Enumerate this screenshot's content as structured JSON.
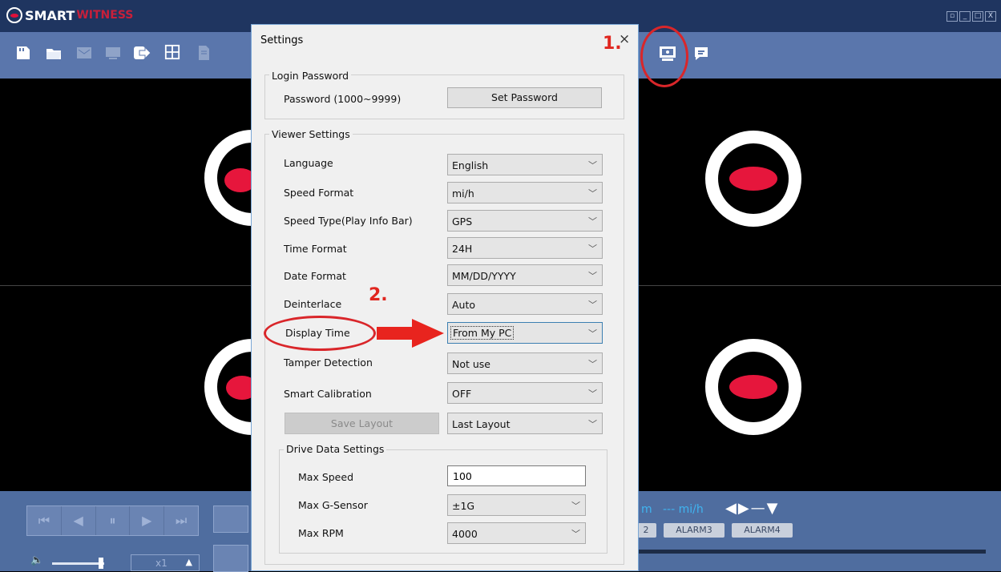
{
  "app": {
    "logo_text_1": "SMART",
    "logo_text_2": "WITNESS"
  },
  "window_controls": [
    "▫",
    "_",
    "□",
    "X"
  ],
  "dialog": {
    "title": "Settings",
    "close_glyph": "×",
    "login_password": {
      "legend": "Login Password",
      "password_label": "Password (1000~9999)",
      "set_password_button": "Set Password"
    },
    "viewer_settings": {
      "legend": "Viewer Settings",
      "rows": [
        {
          "label": "Language",
          "value": "English"
        },
        {
          "label": "Speed Format",
          "value": "mi/h"
        },
        {
          "label": "Speed Type(Play Info Bar)",
          "value": "GPS"
        },
        {
          "label": "Time Format",
          "value": "24H"
        },
        {
          "label": "Date Format",
          "value": "MM/DD/YYYY"
        },
        {
          "label": "Deinterlace",
          "value": "Auto"
        },
        {
          "label": "Display Time",
          "value": "From My PC"
        },
        {
          "label": "Tamper Detection",
          "value": "Not use"
        },
        {
          "label": "Smart Calibration",
          "value": "OFF"
        }
      ],
      "save_layout_button": "Save Layout",
      "layout_select": "Last Layout"
    },
    "drive_data": {
      "legend": "Drive Data Settings",
      "max_speed_label": "Max Speed",
      "max_speed_value": "100",
      "max_gsensor_label": "Max G-Sensor",
      "max_gsensor_value": "±1G",
      "max_rpm_label": "Max RPM",
      "max_rpm_value": "4000"
    }
  },
  "annotations": {
    "step1": "1.",
    "step2": "2."
  },
  "playback": {
    "speed_label": "x1",
    "speed_up": "▲",
    "info_unit_m": "m",
    "info_speed": "--- mi/h",
    "arrows": "◀▶—▼",
    "alarms": [
      "2",
      "ALARM3",
      "ALARM4"
    ],
    "buttons": [
      "⏮",
      "◀",
      "⏸",
      "▶",
      "⏭"
    ],
    "volume_icon": "🔈"
  },
  "colors": {
    "titlebar": "#1f3560",
    "toolbar": "#5a76ac",
    "accent_red": "#e6163c",
    "annotation_red": "#d9262a"
  }
}
